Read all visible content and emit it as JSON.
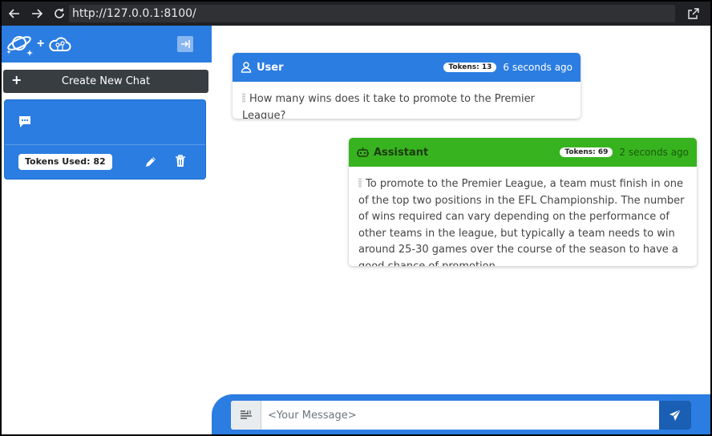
{
  "browser": {
    "url": "http://127.0.0.1:8100/"
  },
  "sidebar": {
    "new_chat_label": "Create New Chat",
    "new_chat_plus": "+",
    "logo_plus": "+",
    "chats": [
      {
        "tokens_label": "Tokens Used: 82"
      }
    ]
  },
  "messages": [
    {
      "role": "User",
      "tokens": "Tokens: 13",
      "time": "6 seconds ago",
      "text": "How many wins does it take to promote to the Premier League?"
    },
    {
      "role": "Assistant",
      "tokens": "Tokens: 69",
      "time": "2 seconds ago",
      "text": "To promote to the Premier League, a team must finish in one of the top two positions in the EFL Championship. The number of wins required can vary depending on the performance of other teams in the league, but typically a team needs to win around 25-30 games over the course of the season to have a good chance of promotion."
    }
  ],
  "input": {
    "placeholder": "<Your Message>"
  },
  "colors": {
    "primary": "#2b7de1",
    "assistant": "#37b31f",
    "dark_button": "#383d42",
    "send": "#1a5fb4"
  }
}
